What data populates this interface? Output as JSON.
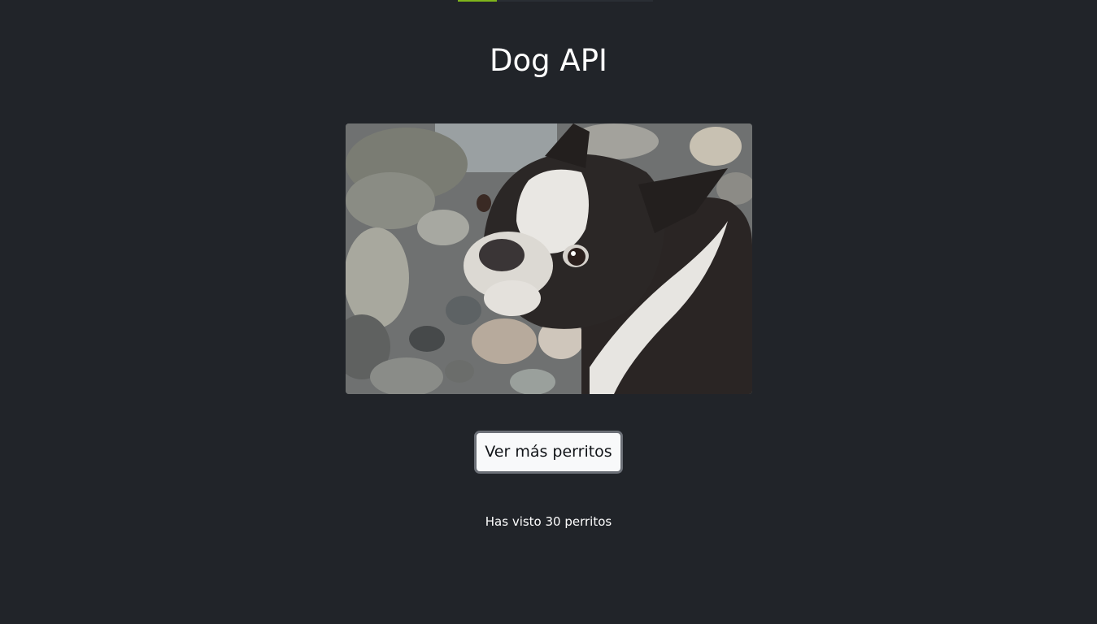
{
  "page": {
    "title": "Dog API",
    "button_label": "Ver más perritos",
    "counter_text": "Has visto 30 perritos"
  },
  "image": {
    "subject": "boston-terrier-on-river-stones"
  },
  "colors": {
    "background": "#212429",
    "accent": "#7fb51b",
    "button_bg": "#f8f9fa",
    "button_border": "#6c7077"
  }
}
